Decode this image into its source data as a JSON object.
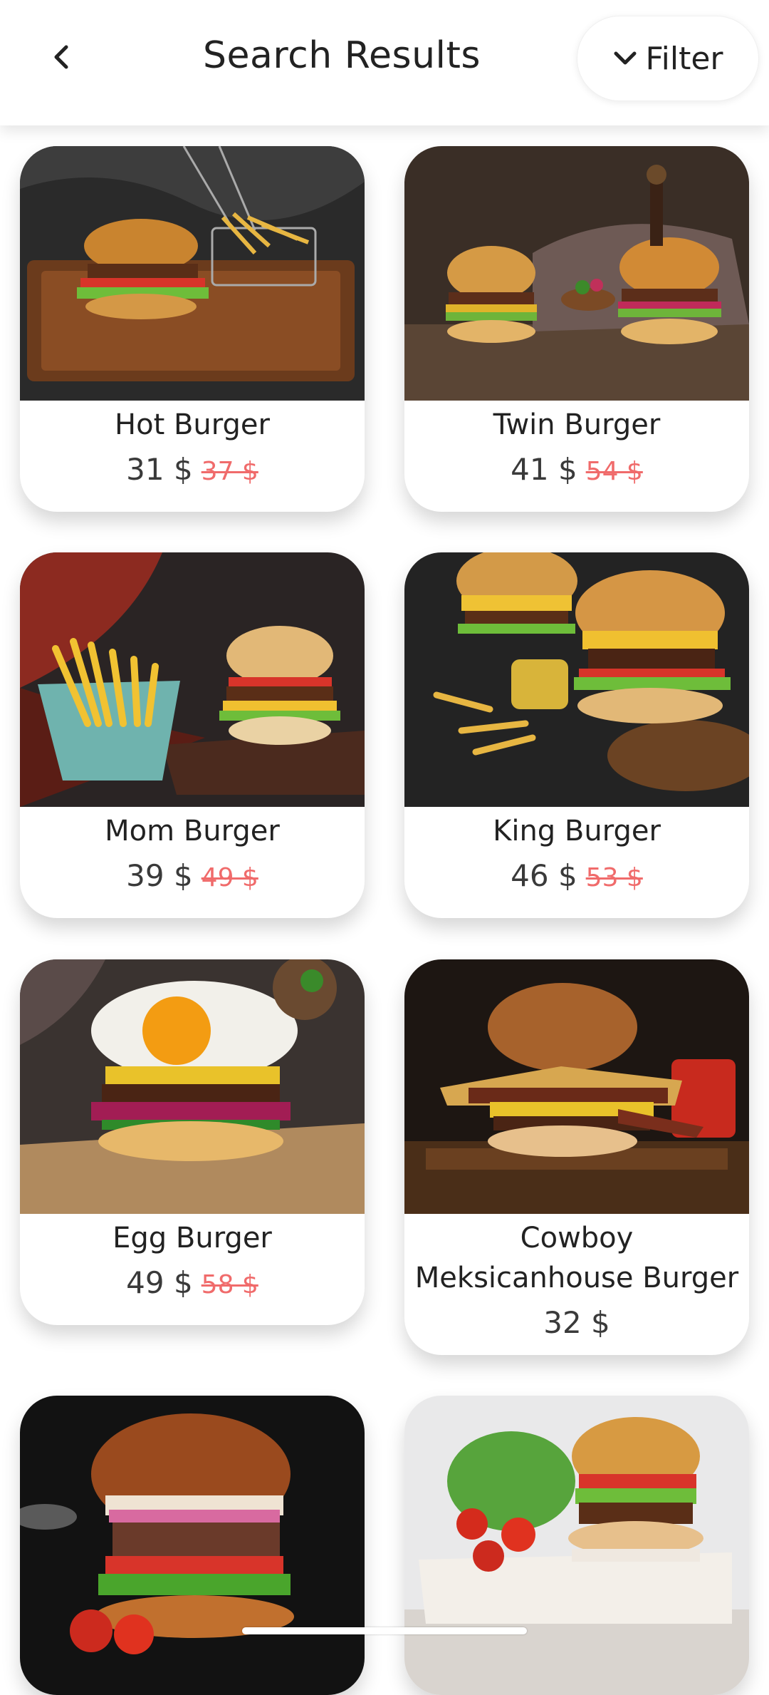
{
  "header": {
    "title": "Search Results",
    "back_icon": "chevron-left-icon",
    "filter_label": "Filter",
    "filter_icon": "chevron-down-icon"
  },
  "colors": {
    "old_price": "#f06b6b",
    "text": "#222222",
    "background": "#ffffff"
  },
  "results": [
    {
      "name": "Hot Burger",
      "price": "31 $",
      "old_price": "37 $"
    },
    {
      "name": "Twin Burger",
      "price": "41 $",
      "old_price": "54 $"
    },
    {
      "name": "Mom Burger",
      "price": "39 $",
      "old_price": "49 $"
    },
    {
      "name": "King Burger",
      "price": "46 $",
      "old_price": "53 $"
    },
    {
      "name": "Egg Burger",
      "price": "49 $",
      "old_price": "58 $"
    },
    {
      "name": "Cowboy Meksicanhouse Burger",
      "price": "32 $",
      "old_price": ""
    },
    {
      "name": "",
      "price": "",
      "old_price": ""
    },
    {
      "name": "",
      "price": "",
      "old_price": ""
    }
  ]
}
